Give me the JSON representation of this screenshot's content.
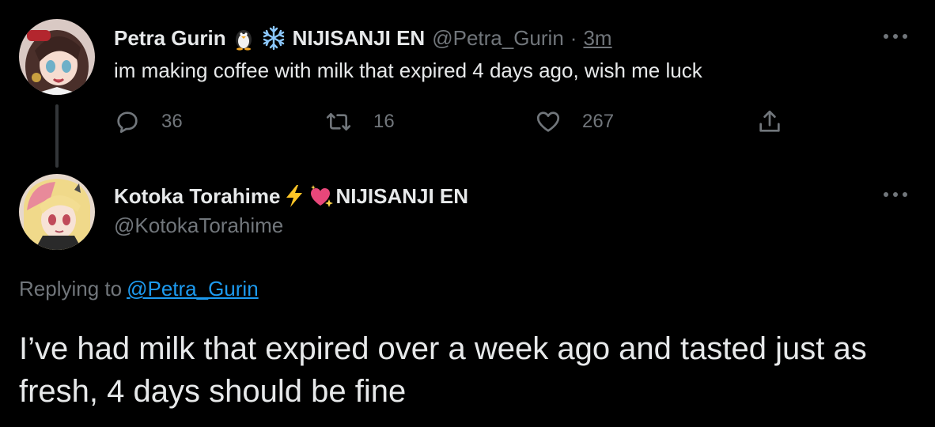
{
  "tweet1": {
    "author_name": "Petra Gurin",
    "author_emoji": [
      "penguin-icon",
      "snowflake-icon"
    ],
    "author_org": "NIJISANJI EN",
    "handle": "@Petra_Gurin",
    "separator": "·",
    "time": "3m",
    "text": "im making coffee with milk that expired 4 days ago, wish me luck",
    "actions": {
      "replies": "36",
      "retweets": "16",
      "likes": "267"
    }
  },
  "tweet2": {
    "author_name": "Kotoka Torahime",
    "author_emoji": [
      "lightning-icon",
      "sparkling-heart-icon"
    ],
    "author_org": "NIJISANJI EN",
    "handle": "@KotokaTorahime",
    "replying_prefix": "Replying to",
    "replying_to": "@Petra_Gurin",
    "text": "I’ve had milk that expired over a week ago and tasted just as fresh, 4 days should be fine"
  },
  "colors": {
    "background": "#000000",
    "text_primary": "#e7e9ea",
    "text_secondary": "#71767b",
    "link": "#1d9bf0",
    "thread_line": "#333639"
  }
}
